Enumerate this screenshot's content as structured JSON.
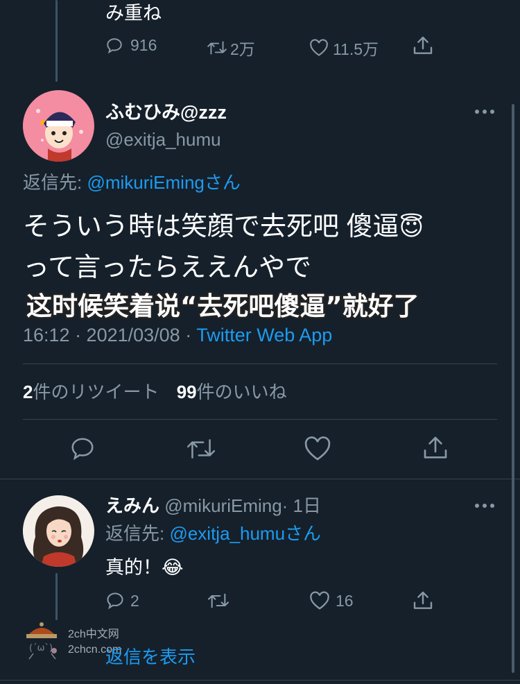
{
  "prev_tweet": {
    "text_tail": "み重ね",
    "replies": "916",
    "retweets": "2万",
    "likes": "11.5万"
  },
  "main_tweet": {
    "display_name": "ふむひみ@zzz",
    "handle": "@exitja_humu",
    "reply_to_prefix": "返信先: ",
    "reply_to_handle": "@mikuriEming",
    "reply_to_suffix": "さん",
    "text_line1": "そういう時は笑顔で去死吧 傻逼",
    "text_line1_emoji": "😇",
    "text_line2": "って言ったらええんやで",
    "caption": "这时候笑着说“去死吧傻逼”就好了",
    "timestamp": "16:12 · 2021/03/08 · ",
    "source": "Twitter Web App",
    "retweet_count": "2",
    "retweet_label": "件のリツイート",
    "like_count": "99",
    "like_label": "件のいいね"
  },
  "reply_tweet": {
    "display_name": "えみん",
    "handle": "@mikuriEming",
    "time": "· 1日",
    "reply_to_prefix": "返信先: ",
    "reply_to_handle": "@exitja_humu",
    "reply_to_suffix": "さん",
    "text": "真的！",
    "text_emoji": "😂",
    "replies": "2",
    "retweets": "",
    "likes": "16"
  },
  "show_replies_label": "返信を表示",
  "watermark": {
    "line1": "2ch中文网",
    "line2": "2chcn.com"
  },
  "colors": {
    "background": "#15202b",
    "link": "#1d9bf0",
    "muted": "#8899a6",
    "divider": "#38444d"
  }
}
